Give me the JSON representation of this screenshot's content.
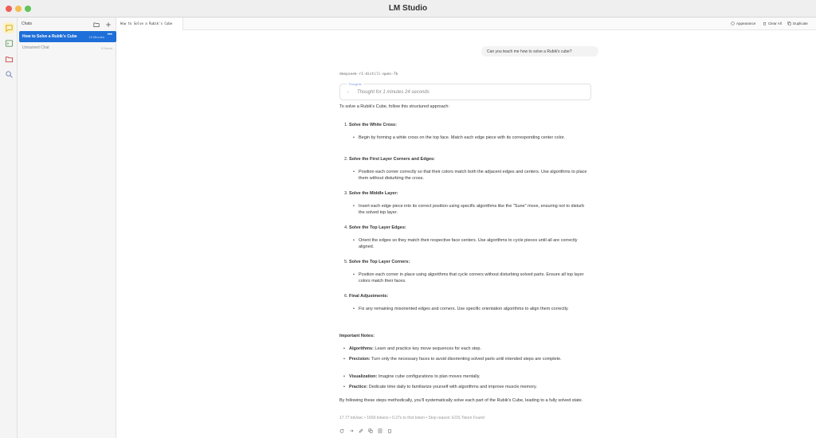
{
  "window": {
    "title": "LM Studio"
  },
  "sidebar": {
    "title": "Chats",
    "chats": [
      {
        "name": "How to Solve a Rubik's Cube",
        "time": "19 Minutes",
        "selected": true
      },
      {
        "name": "Unnamed Chat",
        "time": "0 Hours",
        "selected": false
      }
    ]
  },
  "tabbar": {
    "active_tab": "How to Solve a Rubik's Cube",
    "tools": {
      "appearance": "Appearance",
      "clear_all": "Clear All",
      "duplicate": "Duplicate"
    }
  },
  "conversation": {
    "user_message": "Can you teach me how to solve a Rubik's cube?",
    "model_name": "deepseek-r1-distill-qwen-7b",
    "thoughts_label": "Thoughts",
    "thought_duration": "Thought for 1 minutes 24 seconds",
    "intro": "To solve a Rubik's Cube, follow this structured approach:",
    "steps": [
      {
        "num": "1.",
        "title": "Solve the White Cross:",
        "body": "Begin by forming a white cross on the top face. Match each edge piece with its corresponding center color."
      },
      {
        "num": "2.",
        "title": "Solve the First Layer Corners and Edges:",
        "body": "Position each corner correctly so that their colors match both the adjacent edges and centers. Use algorithms to place them without disturbing the cross."
      },
      {
        "num": "3.",
        "title": "Solve the Middle Layer:",
        "body": "Insert each edge piece into its correct position using specific algorithms like the \"Sune\" move, ensuring not to disturb the solved top layer."
      },
      {
        "num": "4.",
        "title": "Solve the Top Layer Edges:",
        "body": "Orient the edges so they match their respective face centers. Use algorithms to cycle pieces until all are correctly aligned."
      },
      {
        "num": "5.",
        "title": "Solve the Top Layer Corners:",
        "body": "Position each corner in place using algorithms that cycle corners without disturbing solved parts. Ensure all top layer colors match their faces."
      },
      {
        "num": "6.",
        "title": "Final Adjustments:",
        "body": "Fix any remaining misoriented edges and corners. Use specific orientation algorithms to align them correctly."
      }
    ],
    "notes_title": "Important Notes:",
    "notes": [
      {
        "label": "Algorithms:",
        "text": "Learn and practice key move sequences for each step."
      },
      {
        "label": "Precision:",
        "text": "Turn only the necessary faces to avoid disorienting solved parts until intended steps are complete."
      },
      {
        "label": "Visualization:",
        "text": "Imagine cube configurations to plan moves mentally."
      },
      {
        "label": "Practice:",
        "text": "Dedicate time daily to familiarize yourself with algorithms and improve muscle memory."
      }
    ],
    "closing": "By following these steps methodically, you'll systematically solve each part of the Rubik's Cube, leading to a fully solved state.",
    "stats": "17.77 tok/sec • 1659 tokens • 0.27s to first token • Stop reason: EOS Token Found"
  },
  "icons": {
    "rail": [
      "chat-icon",
      "terminal-icon",
      "folder-icon",
      "search-icon"
    ],
    "actions": [
      "regenerate-icon",
      "continue-icon",
      "edit-icon",
      "copy-icon",
      "branch-icon",
      "delete-icon"
    ]
  },
  "colors": {
    "accent": "#1e6fd9",
    "active_rail": "#fbf2c9"
  }
}
